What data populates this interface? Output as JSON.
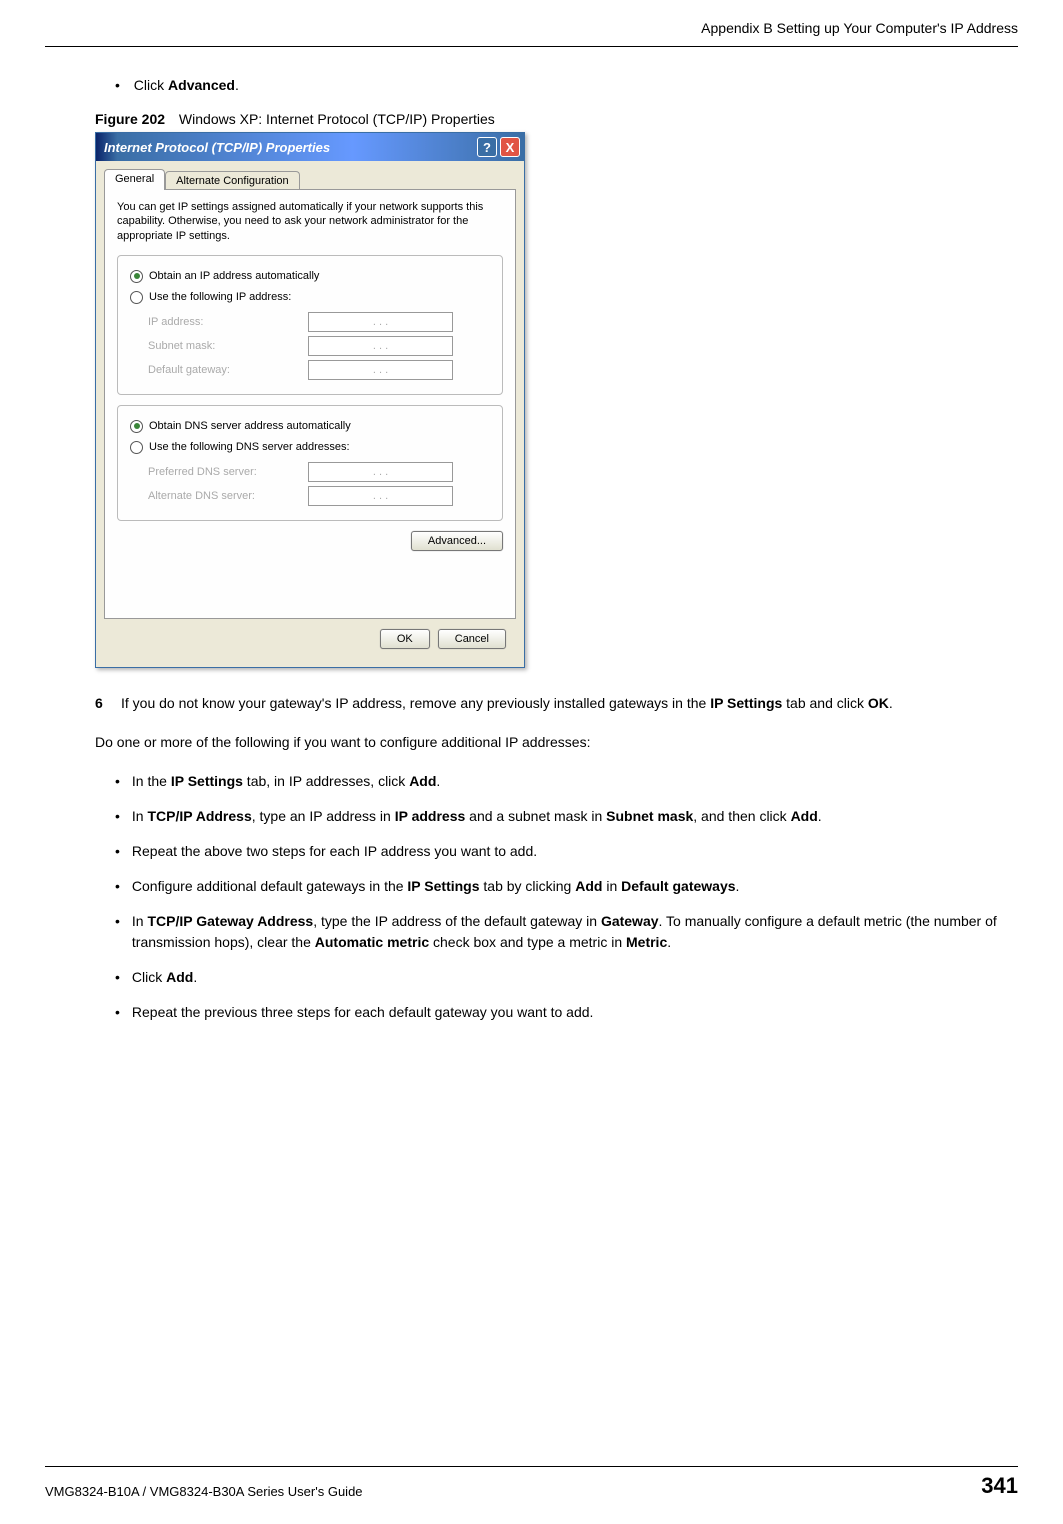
{
  "header": {
    "right": "Appendix B Setting up Your Computer's IP Address"
  },
  "intro_bullet": {
    "prefix": "Click ",
    "bold": "Advanced",
    "suffix": "."
  },
  "figure": {
    "label": "Figure 202",
    "caption": "Windows XP: Internet Protocol (TCP/IP) Properties"
  },
  "dialog": {
    "title": "Internet Protocol (TCP/IP) Properties",
    "help": "?",
    "close": "X",
    "tab_general": "General",
    "tab_alternate": "Alternate Configuration",
    "description": "You can get IP settings assigned automatically if your network supports this capability. Otherwise, you need to ask your network administrator for the appropriate IP settings.",
    "radio_obtain_ip": "Obtain an IP address automatically",
    "radio_use_ip": "Use the following IP address:",
    "label_ip": "IP address:",
    "label_subnet": "Subnet mask:",
    "label_gateway": "Default gateway:",
    "radio_obtain_dns": "Obtain DNS server address automatically",
    "radio_use_dns": "Use the following DNS server addresses:",
    "label_pref_dns": "Preferred DNS server:",
    "label_alt_dns": "Alternate DNS server:",
    "advanced_btn": "Advanced...",
    "ok_btn": "OK",
    "cancel_btn": "Cancel",
    "dots": ".       .       ."
  },
  "step6": {
    "num": "6",
    "p1_a": "If you do not know your gateway's IP address, remove any previously installed gateways in the ",
    "p1_b": "IP Settings",
    "p1_c": " tab and click ",
    "p1_d": "OK",
    "p1_e": "."
  },
  "do_one": "Do one or more of the following if you want to configure additional IP addresses:",
  "bullets": {
    "b1": {
      "a": "In the ",
      "b": "IP Settings",
      "c": " tab, in IP addresses, click ",
      "d": "Add",
      "e": "."
    },
    "b2": {
      "a": "In ",
      "b": "TCP/IP Address",
      "c": ", type an IP address in ",
      "d": "IP address",
      "e": " and a subnet mask in ",
      "f": "Subnet mask",
      "g": ", and then click ",
      "h": "Add",
      "i": "."
    },
    "b3": {
      "a": "Repeat the above two steps for each IP address you want to add."
    },
    "b4": {
      "a": "Configure additional default gateways in the ",
      "b": "IP Settings",
      "c": " tab by clicking ",
      "d": "Add",
      "e": " in ",
      "f": "Default gateways",
      "g": "."
    },
    "b5": {
      "a": "In ",
      "b": "TCP/IP Gateway Address",
      "c": ", type the IP address of the default gateway in ",
      "d": "Gateway",
      "e": ". To manually configure a default metric (the number of transmission hops), clear the ",
      "f": "Automatic metric",
      "g": " check box and type a metric in ",
      "h": "Metric",
      "i": "."
    },
    "b6": {
      "a": "Click ",
      "b": "Add",
      "c": "."
    },
    "b7": {
      "a": "Repeat the previous three steps for each default gateway you want to add."
    }
  },
  "footer": {
    "left": "VMG8324-B10A / VMG8324-B30A Series User's Guide",
    "page": "341"
  }
}
